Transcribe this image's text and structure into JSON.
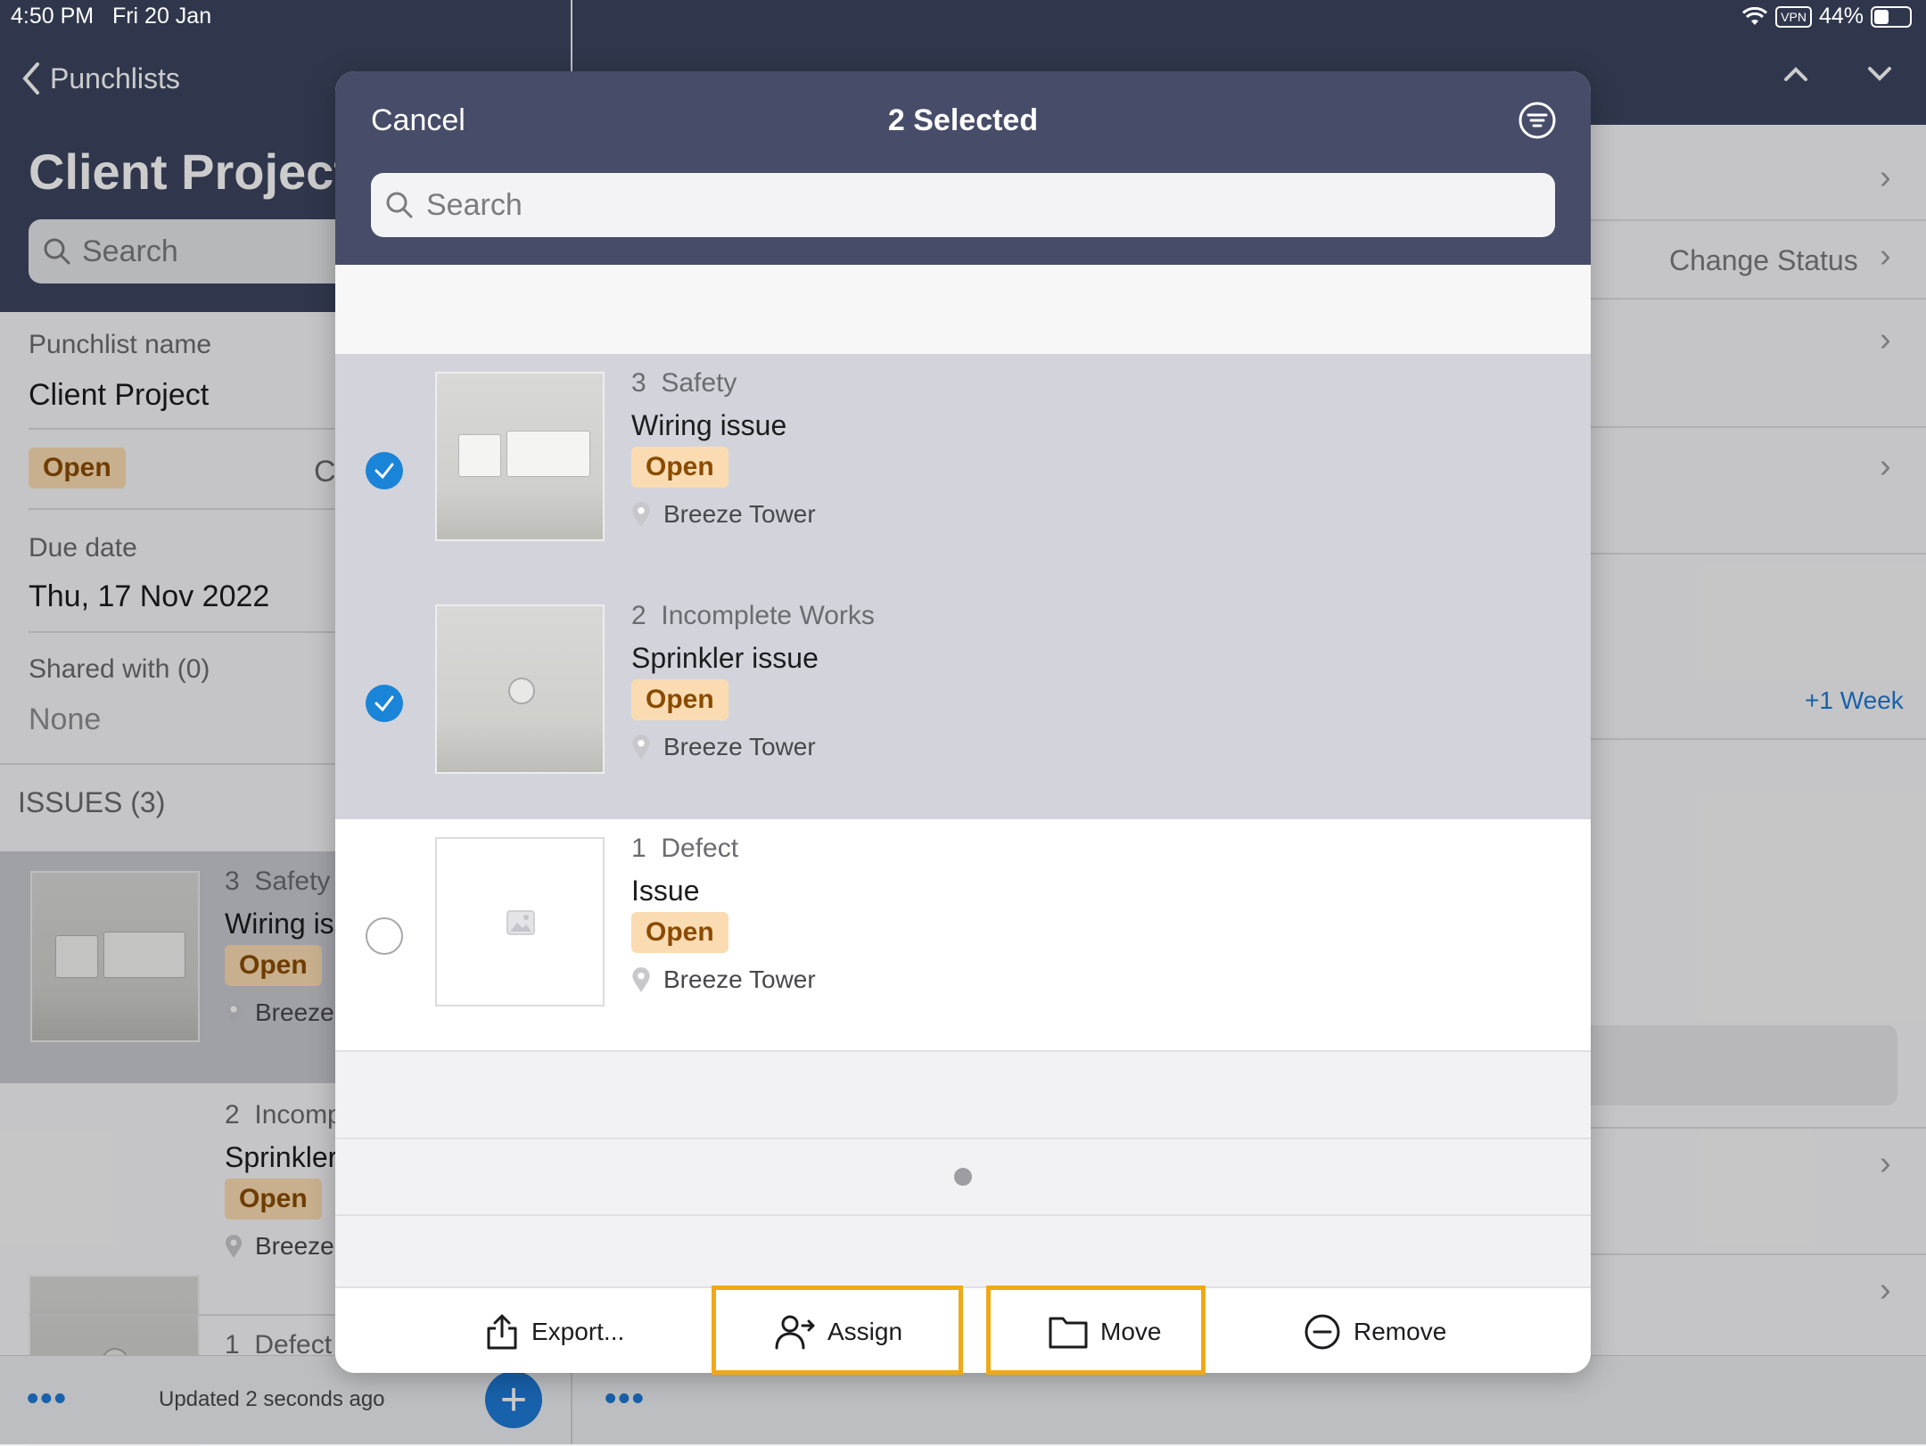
{
  "status_bar": {
    "time": "4:50 PM",
    "date": "Fri 20 Jan",
    "vpn": "VPN",
    "battery": "44%"
  },
  "left_pane": {
    "back_label": "Punchlists",
    "title": "Client Project",
    "search_placeholder": "Search",
    "punchlist_name_label": "Punchlist name",
    "punchlist_name_value": "Client Project",
    "status_badge": "Open",
    "status_side_letter": "C",
    "due_date_label": "Due date",
    "due_date_value": "Thu, 17 Nov 2022",
    "shared_with_label": "Shared with (0)",
    "shared_with_value": "None",
    "issues_header": "ISSUES (3)",
    "issues": [
      {
        "number": "3",
        "category": "Safety",
        "title": "Wiring iss",
        "status": "Open",
        "location": "Breeze"
      },
      {
        "number": "2",
        "category": "Incomp",
        "title": "Sprinkler",
        "status": "Open",
        "location": "Breeze"
      },
      {
        "number": "1",
        "category": "Defect"
      }
    ],
    "updated_text": "Updated 2 seconds ago"
  },
  "right_pane": {
    "change_status": "Change Status",
    "plus_week": "+1 Week"
  },
  "modal": {
    "cancel_label": "Cancel",
    "title": "2 Selected",
    "search_placeholder": "Search",
    "issues": [
      {
        "number": "3",
        "category": "Safety",
        "title": "Wiring issue",
        "status": "Open",
        "location": "Breeze Tower",
        "selected": true
      },
      {
        "number": "2",
        "category": "Incomplete Works",
        "title": "Sprinkler issue",
        "status": "Open",
        "location": "Breeze Tower",
        "selected": true
      },
      {
        "number": "1",
        "category": "Defect",
        "title": "Issue",
        "status": "Open",
        "location": "Breeze Tower",
        "selected": false
      }
    ],
    "toolbar": {
      "export_label": "Export...",
      "assign_label": "Assign",
      "move_label": "Move",
      "remove_label": "Remove"
    }
  },
  "colors": {
    "header_bg": "#474c69",
    "accent_blue": "#1a84d8",
    "badge_bg": "#fbdcb2",
    "badge_text": "#8a4b00",
    "highlight": "#f0a818"
  }
}
